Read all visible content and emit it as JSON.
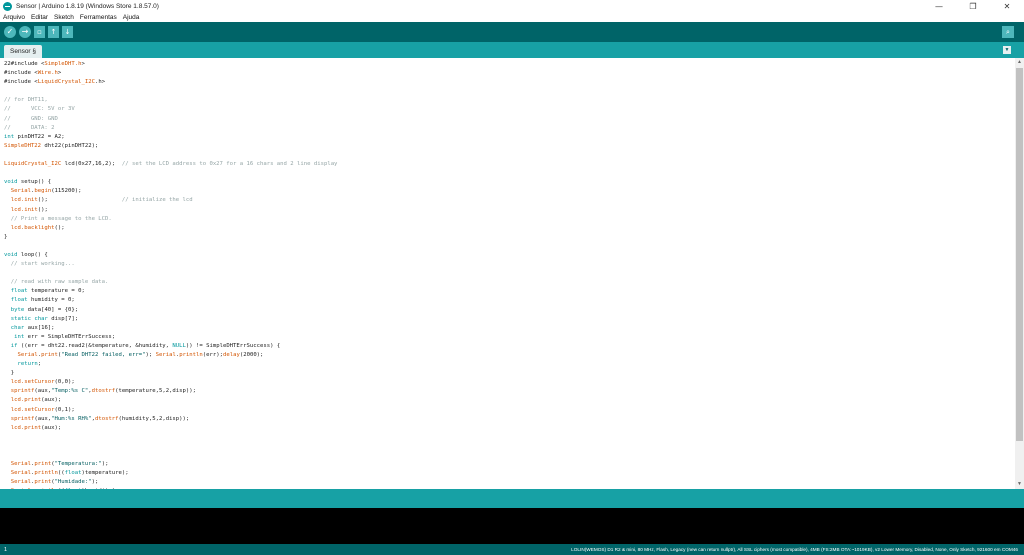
{
  "window": {
    "title": "Sensor | Arduino 1.8.19 (Windows Store 1.8.57.0)",
    "controls": {
      "minimize": "—",
      "maximize": "❐",
      "close": "✕"
    }
  },
  "menu": [
    "Arquivo",
    "Editar",
    "Sketch",
    "Ferramentas",
    "Ajuda"
  ],
  "toolbar": {
    "verify_icon": "✓",
    "upload_icon": "→",
    "new_icon": "▫",
    "open_icon": "↑",
    "save_icon": "↓",
    "serial_monitor_icon": "⌕"
  },
  "tabs": [
    {
      "label": "Sensor §"
    }
  ],
  "tab_menu_icon": "▼",
  "editor": {
    "lines": [
      "22#include <SimpleDHT.h>",
      "#include <Wire.h>",
      "#include <LiquidCrystal_I2C.h>",
      "",
      "// for DHT11,",
      "//      VCC: 5V or 3V",
      "//      GND: GND",
      "//      DATA: 2",
      "int pinDHT22 = A2;",
      "SimpleDHT22 dht22(pinDHT22);",
      "",
      "LiquidCrystal_I2C lcd(0x27,16,2);  // set the LCD address to 0x27 for a 16 chars and 2 line display",
      "",
      "void setup() {",
      "  Serial.begin(115200);",
      "  lcd.init();                      // initialize the lcd",
      "  lcd.init();",
      "  // Print a message to the LCD.",
      "  lcd.backlight();",
      "}",
      "",
      "void loop() {",
      "  // start working...",
      "",
      "  // read with raw sample data.",
      "  float temperature = 0;",
      "  float humidity = 0;",
      "  byte data[40] = {0};",
      "  static char disp[7];",
      "  char aux[16];",
      "   int err = SimpleDHTErrSuccess;",
      "  if ((err = dht22.read2(&temperature, &humidity, NULL)) != SimpleDHTErrSuccess) {",
      "    Serial.print(\"Read DHT22 failed, err=\"); Serial.println(err);delay(2000);",
      "    return;",
      "  }",
      "  lcd.setCursor(0,0);",
      "  sprintf(aux,\"Temp:%s C\",dtostrf(temperature,5,2,disp));",
      "  lcd.print(aux);",
      "  lcd.setCursor(0,1);",
      "  sprintf(aux,\"Hum:%s RH%\",dtostrf(humidity,5,2,disp));",
      "  lcd.print(aux);",
      "",
      "",
      "",
      "  Serial.print(\"Temperatura:\");",
      "  Serial.println((float)temperature);",
      "  Serial.print(\"Humidade:\");",
      "  Serial.println((float)humidity);"
    ]
  },
  "scroll": {
    "up": "▲",
    "down": "▼"
  },
  "status": {
    "line": "1",
    "board": "LOLIN(WEMOS) D1 R2 & mini, 80 MHz, Flash, Legacy (new can return nullptr), All SSL ciphers (most compatible), 4MB (FS:2MB OTA:~1019KB), v2 Lower Memory, Disabled, None, Only Sketch, 921600 em COM46"
  },
  "colors": {
    "toolbar": "#006468",
    "tabbar": "#17a1a5",
    "button": "#4db7bb",
    "keyword_type": "#00979c",
    "keyword_lib": "#d35400",
    "comment": "#95a5a6",
    "string": "#005c5f"
  }
}
